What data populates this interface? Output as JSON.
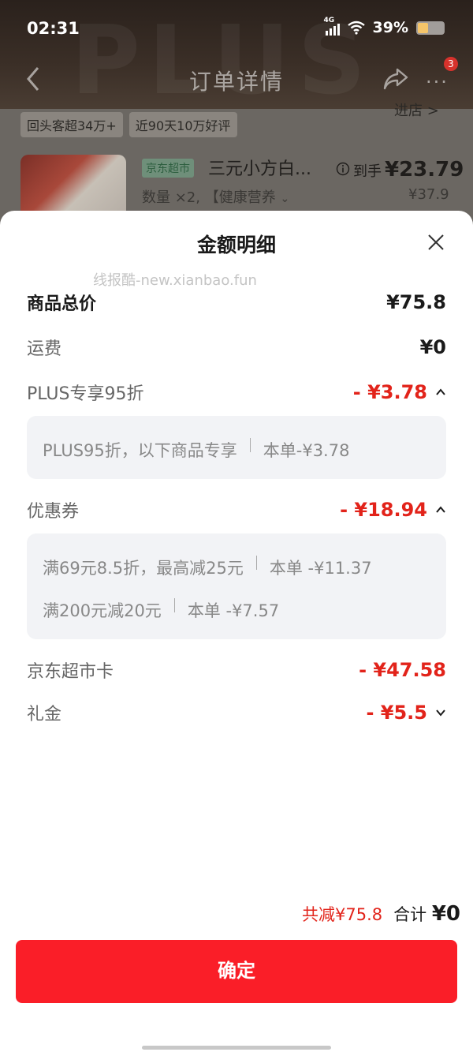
{
  "status_bar": {
    "time": "02:31",
    "network": "4G",
    "battery": "39%"
  },
  "nav": {
    "title": "订单详情",
    "badge": "3"
  },
  "background": {
    "tags": [
      "回头客超34万+",
      "近90天10万好评"
    ],
    "store_link": "进店 >",
    "product": {
      "store_tag": "京东超市",
      "name": "三元小方白...",
      "spec": "数量 ×2, 【健康营养",
      "price_label": "到手",
      "price": "¥23.79",
      "original_price": "¥37.9"
    }
  },
  "sheet": {
    "title": "金额明细",
    "watermark": "线报酷-new.xianbao.fun",
    "rows": {
      "goods_total": {
        "label": "商品总价",
        "value": "¥75.8"
      },
      "shipping": {
        "label": "运费",
        "value": "¥0"
      },
      "plus": {
        "label": "PLUS专享95折",
        "value": "- ¥3.78"
      },
      "coupon": {
        "label": "优惠券",
        "value": "- ¥18.94"
      },
      "card": {
        "label": "京东超市卡",
        "value": "- ¥47.58"
      },
      "gift": {
        "label": "礼金",
        "value": "- ¥5.5"
      }
    },
    "plus_detail": {
      "desc": "PLUS95折，以下商品专享",
      "amount": "本单-¥3.78"
    },
    "coupon_detail": [
      {
        "desc": "满69元8.5折，最高减25元",
        "amount": "本单 -¥11.37"
      },
      {
        "desc": "满200元减20元",
        "amount": "本单 -¥7.57"
      }
    ],
    "summary": {
      "reduce": "共减¥75.8",
      "sum_label": "合计",
      "sum_value": "¥0"
    },
    "confirm_label": "确定"
  },
  "colors": {
    "accent_red": "#e2231a",
    "button_red": "#fa1e28"
  }
}
